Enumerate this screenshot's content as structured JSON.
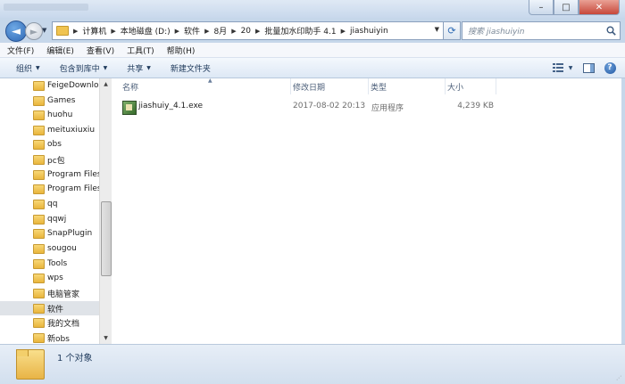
{
  "window": {
    "controls": {
      "minimize": "–",
      "maximize": "□",
      "close": "✕"
    }
  },
  "nav": {
    "back_glyph": "◄",
    "forward_glyph": "►",
    "breadcrumbs": [
      "计算机",
      "本地磁盘 (D:)",
      "软件",
      "8月",
      "20",
      "批量加水印助手 4.1",
      "jiashuiyin"
    ],
    "search_placeholder": "搜索 jiashuiyin"
  },
  "menu": [
    "文件(F)",
    "编辑(E)",
    "查看(V)",
    "工具(T)",
    "帮助(H)"
  ],
  "toolbar": {
    "organize": "组织",
    "include_library": "包含到库中",
    "share": "共享",
    "new_folder": "新建文件夹"
  },
  "tree": [
    "FeigeDownloa",
    "Games",
    "huohu",
    "meituxiuxiu",
    "obs",
    "pc包",
    "Program Files",
    "Program Files",
    "qq",
    "qqwj",
    "SnapPlugin",
    "sougou",
    "Tools",
    "wps",
    "电脑管家",
    "软件",
    "我的文档",
    "新obs"
  ],
  "selected_tree_index": 15,
  "columns": {
    "name": "名称",
    "date": "修改日期",
    "type": "类型",
    "size": "大小"
  },
  "files": [
    {
      "name": "jiashuiy_4.1.exe",
      "date": "2017-08-02 20:13",
      "type": "应用程序",
      "size": "4,239 KB"
    }
  ],
  "status": {
    "count": "1 个对象"
  },
  "icons": {
    "back": "back-arrow-icon",
    "forward": "forward-arrow-icon",
    "refresh": "refresh-icon",
    "search": "search-icon",
    "view": "view-options-icon",
    "preview": "preview-pane-icon",
    "help": "help-icon",
    "folder": "folder-icon",
    "exe": "exe-file-icon"
  }
}
